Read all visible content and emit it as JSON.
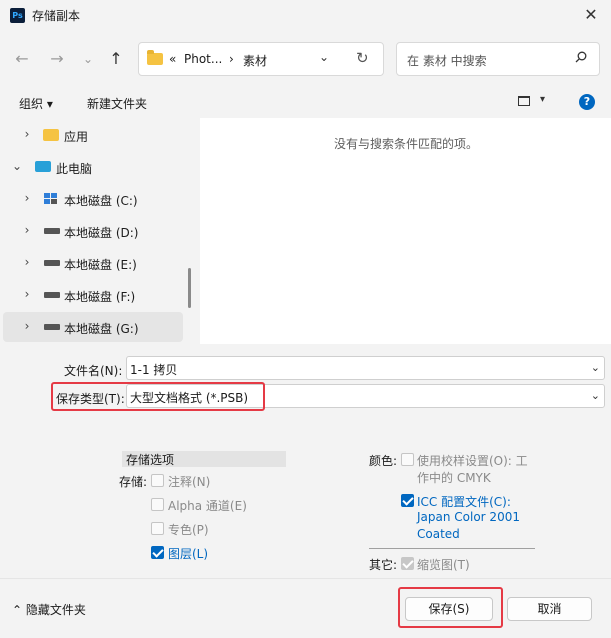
{
  "window": {
    "app_icon": "Ps",
    "title": "存储副本",
    "close": "✕"
  },
  "nav": {
    "back": "←",
    "forward": "→",
    "history": "⌄",
    "up": "↑",
    "breadcrumb_sep": "«",
    "path": [
      "Phot...",
      "素材"
    ],
    "path_arrow": "›",
    "dropdown": "⌄",
    "refresh": "↻",
    "search_placeholder": "在 素材 中搜索"
  },
  "toolbar": {
    "organize": "组织 ▾",
    "new_folder": "新建文件夹",
    "view_dropdown": "▾",
    "help": "?"
  },
  "tree": [
    {
      "label": "应用",
      "icon": "folder-icon",
      "chevron": "›"
    },
    {
      "label": "此电脑",
      "icon": "computer-icon",
      "chevron": "⌄"
    },
    {
      "label": "本地磁盘 (C:)",
      "icon": "windows-drive-icon",
      "chevron": "›"
    },
    {
      "label": "本地磁盘 (D:)",
      "icon": "drive-icon",
      "chevron": "›"
    },
    {
      "label": "本地磁盘 (E:)",
      "icon": "drive-icon",
      "chevron": "›"
    },
    {
      "label": "本地磁盘 (F:)",
      "icon": "drive-icon",
      "chevron": "›"
    },
    {
      "label": "本地磁盘 (G:)",
      "icon": "drive-icon",
      "chevron": "›",
      "selected": true
    }
  ],
  "file_list": {
    "empty_message": "没有与搜索条件匹配的项。"
  },
  "form": {
    "filename_label": "文件名(N):",
    "filename_value": "1-1 拷贝",
    "filetype_label": "保存类型(T):",
    "filetype_value": "大型文档格式 (*.PSB)",
    "dropdown_arrow": "⌄"
  },
  "options": {
    "header": "存储选项",
    "save_label": "存储:",
    "items": [
      {
        "label": "注释(N)",
        "checked": false
      },
      {
        "label": "Alpha 通道(E)",
        "checked": false
      },
      {
        "label": "专色(P)",
        "checked": false
      },
      {
        "label": "图层(L)",
        "checked": true
      }
    ],
    "color_label": "颜色:",
    "proof_line1": "使用校样设置(O):  工",
    "proof_line2": "作中的 CMYK",
    "icc_line1": "ICC 配置文件(C):",
    "icc_line2": "Japan Color 2001",
    "icc_line3": "Coated",
    "other_label": "其它:",
    "thumbnail": "缩览图(T)"
  },
  "footer": {
    "hide_folders": "⌃  隐藏文件夹",
    "save": "保存(S)",
    "cancel": "取消"
  },
  "colors": {
    "accent": "#0067c0",
    "highlight_box": "#e53a45"
  }
}
